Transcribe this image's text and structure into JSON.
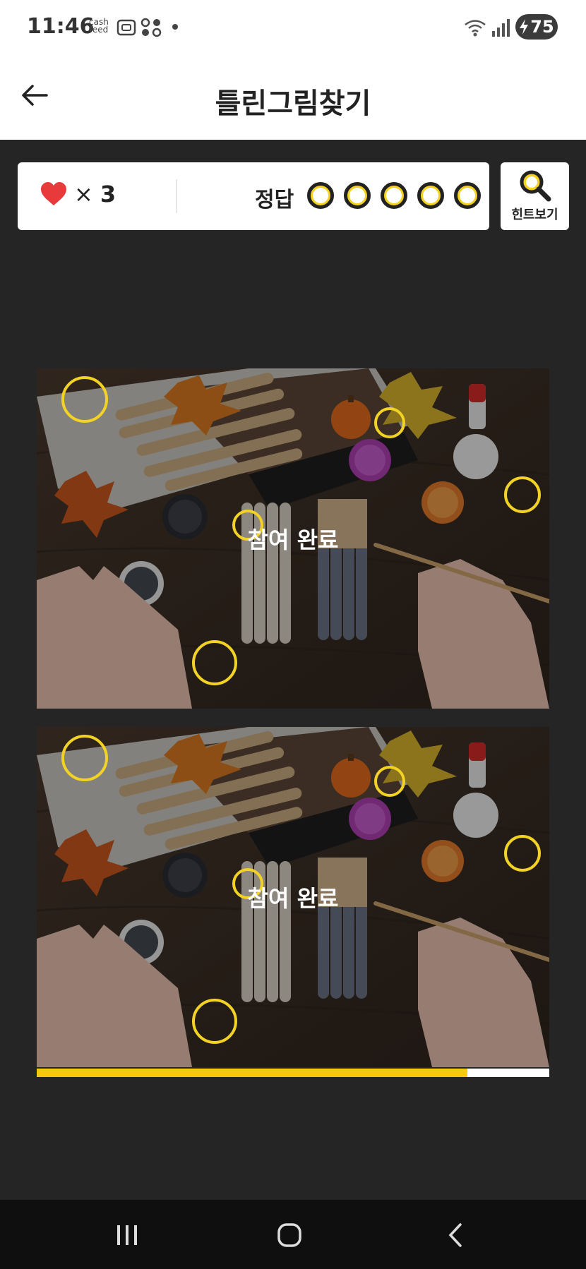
{
  "status_bar": {
    "time": "11:46",
    "cashfeed_top": "cash",
    "cashfeed_bottom": "feed",
    "battery": "75"
  },
  "header": {
    "title": "틀린그림찾기",
    "back_icon": "arrow-left-icon"
  },
  "game_status": {
    "lives_icon": "heart-icon",
    "lives_prefix": "×",
    "lives_count": "3",
    "answer_label": "정답",
    "answer_slots": 5,
    "hint_label": "힌트보기",
    "hint_icon": "magnifier-icon"
  },
  "puzzle": {
    "top_overlay": "참여 완료",
    "bottom_overlay": "참여 완료",
    "progress": 0.84
  },
  "colors": {
    "accent": "#f4d21f",
    "background": "#252525",
    "heart": "#e8393b"
  }
}
